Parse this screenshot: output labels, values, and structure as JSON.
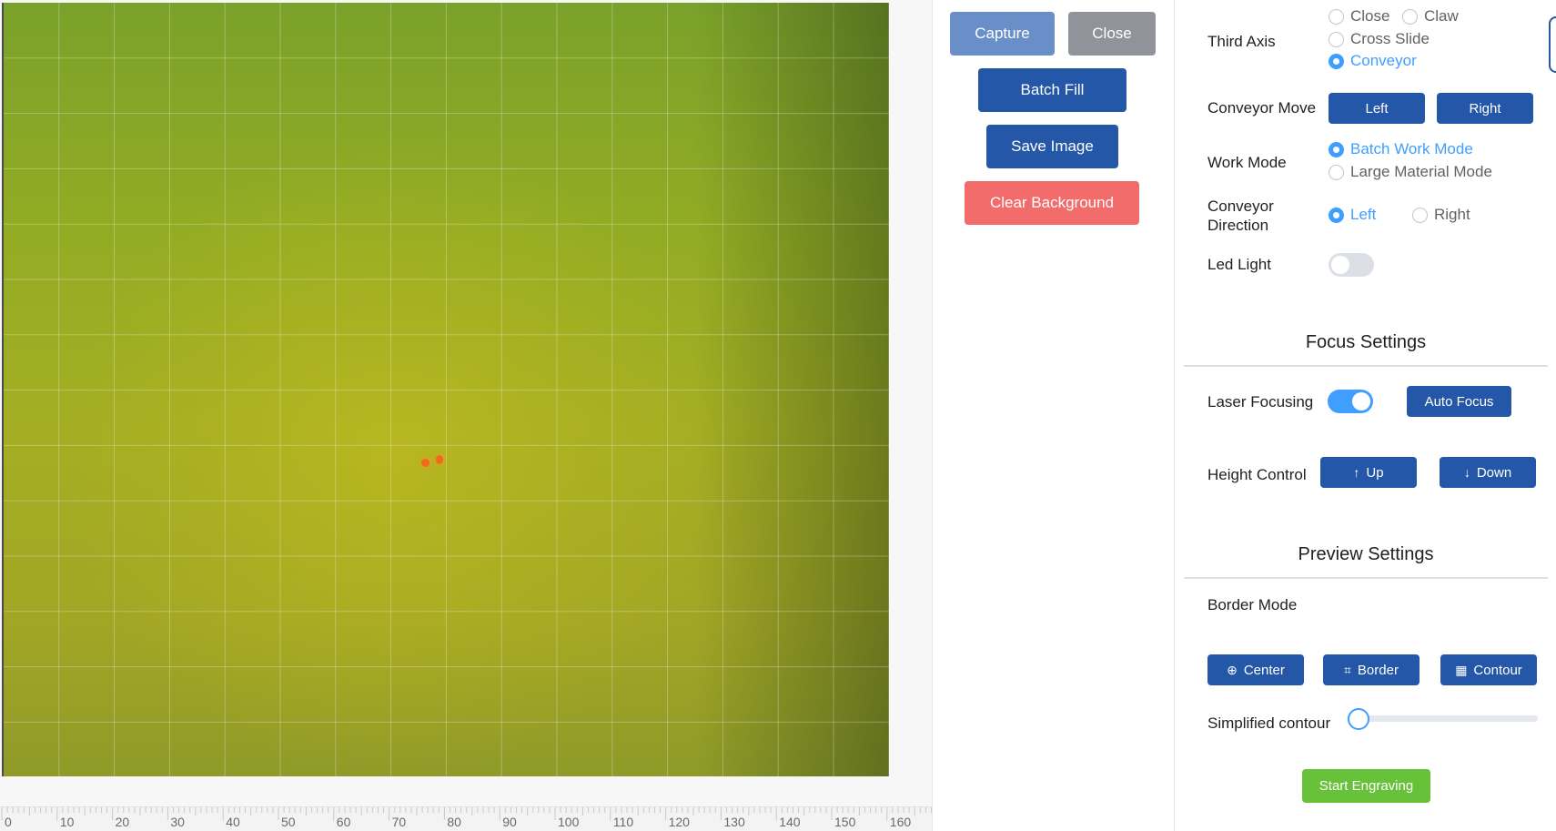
{
  "ruler": {
    "labels": [
      "0",
      "10",
      "20",
      "30",
      "40",
      "50",
      "60",
      "70",
      "80",
      "90",
      "100",
      "110",
      "120",
      "130",
      "140",
      "150",
      "160"
    ]
  },
  "tools": {
    "capture": "Capture",
    "close": "Close",
    "batch_fill": "Batch Fill",
    "save_image": "Save Image",
    "clear_background": "Clear Background"
  },
  "settings": {
    "third_axis": {
      "label": "Third Axis",
      "options": [
        "Close",
        "Claw",
        "Cross Slide",
        "Conveyor"
      ],
      "selected": "Conveyor"
    },
    "conveyor_move": {
      "label": "Conveyor Move",
      "left": "Left",
      "right": "Right"
    },
    "work_mode": {
      "label": "Work Mode",
      "options": [
        "Batch Work Mode",
        "Large Material Mode"
      ],
      "selected": "Batch Work Mode"
    },
    "conveyor_direction": {
      "label_line1": "Conveyor",
      "label_line2": "Direction",
      "options": [
        "Left",
        "Right"
      ],
      "selected": "Left"
    },
    "led_light": {
      "label": "Led Light",
      "on": false
    }
  },
  "focus": {
    "title": "Focus Settings",
    "laser_focusing": {
      "label": "Laser Focusing",
      "on": true
    },
    "auto_focus": "Auto Focus",
    "height_control": {
      "label": "Height Control",
      "up": "Up",
      "down": "Down"
    }
  },
  "preview": {
    "title": "Preview Settings",
    "border_mode": "Border Mode",
    "center": "Center",
    "border": "Border",
    "contour": "Contour",
    "simplified_contour": {
      "label": "Simplified contour",
      "value": 0
    },
    "start_engraving": "Start Engraving"
  },
  "colors": {
    "primary": "#2457a7",
    "accent": "#409eff",
    "danger": "#f36c6c",
    "success": "#67c23a",
    "neutral": "#909399"
  },
  "icons": {
    "up": "arrow-up-icon",
    "down": "arrow-down-icon",
    "center": "crosshair-icon",
    "border": "crop-icon",
    "contour": "grid-icon"
  }
}
